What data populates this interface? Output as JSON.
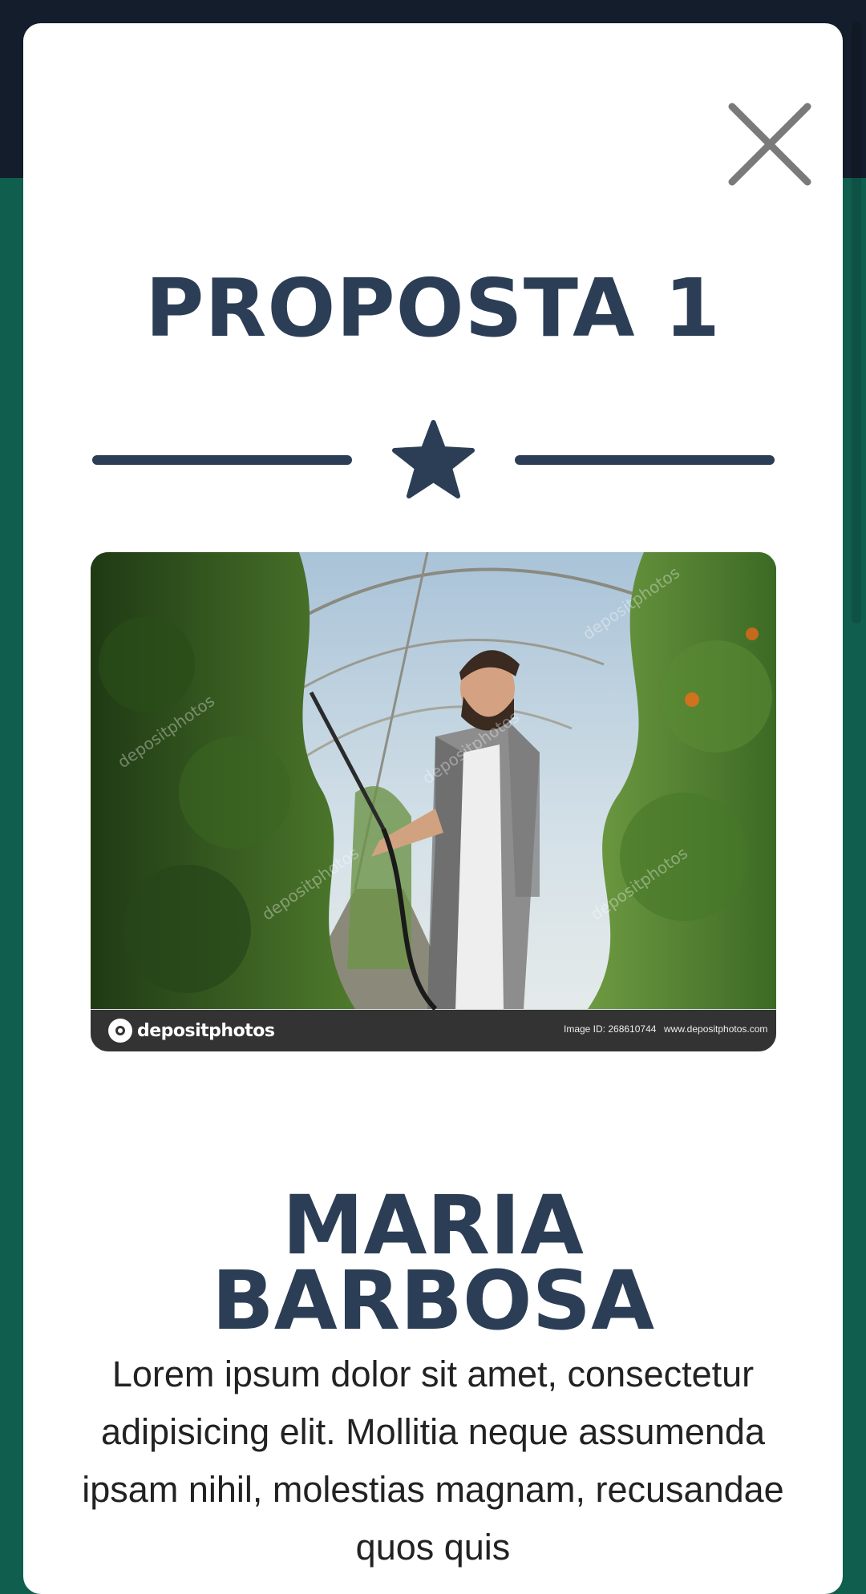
{
  "modal": {
    "title": "PROPOSTA 1",
    "close_icon": "close-icon",
    "divider_icon": "star-icon",
    "photo": {
      "description_icon": "photo-farmer-greenhouse",
      "watermark_brand": "depositphotos",
      "image_id": "Image ID: 268610744",
      "url": "www.depositphotos.com"
    },
    "name_line1": "MARIA",
    "name_line2": "BARBOSA",
    "bio": "Lorem ipsum dolor sit amet, consectetur adipisicing elit. Mollitia neque assumenda ipsam nihil, molestias magnam, recusandae quos quis"
  },
  "colors": {
    "header_bg": "#141d2b",
    "page_bg": "#0f5e4e",
    "modal_bg": "#ffffff",
    "heading": "#2c3e56",
    "close_icon": "#7a7a7a"
  }
}
